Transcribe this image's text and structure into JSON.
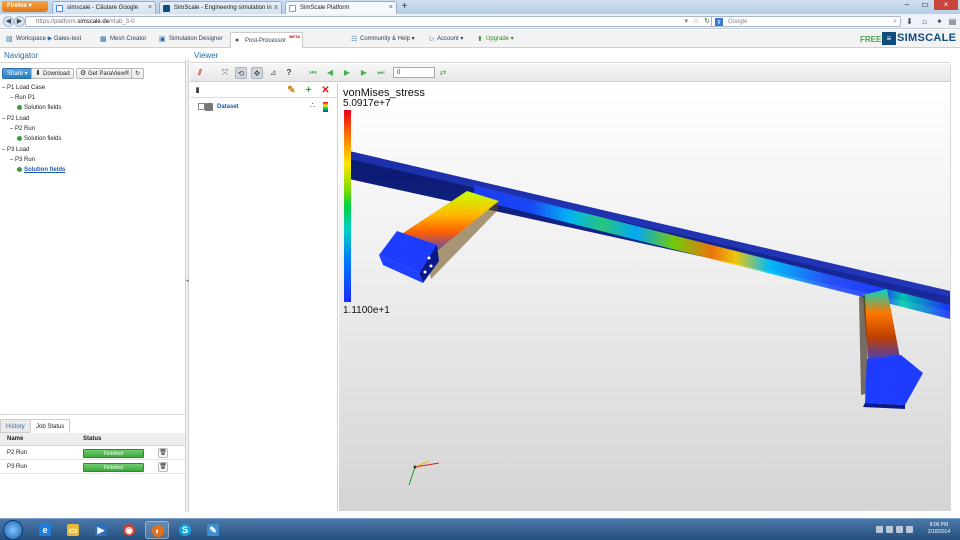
{
  "browser": {
    "menu_label": "Firefox",
    "tabs": [
      {
        "label": "simscale - Căutare Google",
        "active": false
      },
      {
        "label": "SimScale - Engineering simulation in ...",
        "active": false
      },
      {
        "label": "SimScale Platform",
        "active": true
      }
    ],
    "new_tab": "+",
    "url_prefix": "https://platform.",
    "url_host": "simscale.de",
    "url_suffix": "/#tab_3-0",
    "search_placeholder": "Google"
  },
  "app": {
    "breadcrumb_workspace": "Workspace",
    "breadcrumb_project": "Gales-test",
    "tabs": [
      "Mesh Creator",
      "Simulation Designer",
      "Post-Processor"
    ],
    "beta_label": "BETA",
    "menus": [
      "Community & Help",
      "Account",
      "Upgrade"
    ],
    "plan": "FREE",
    "brand": "SIMSCALE"
  },
  "navigator": {
    "title": "Navigator",
    "buttons": [
      "Share",
      "Download",
      "Get ParaView®"
    ],
    "tree": [
      {
        "label": "P1 Load Case",
        "level": 0
      },
      {
        "label": "Run P1",
        "level": 1
      },
      {
        "label": "Solution fields",
        "level": 2
      },
      {
        "label": "P2 Load",
        "level": 0
      },
      {
        "label": "P2 Run",
        "level": 1
      },
      {
        "label": "Solution fields",
        "level": 2
      },
      {
        "label": "P3 Load",
        "level": 0
      },
      {
        "label": "P3 Run",
        "level": 1
      },
      {
        "label": "Solution fields",
        "level": 2
      }
    ]
  },
  "jobs": {
    "tabs": [
      "History",
      "Job Status"
    ],
    "columns": [
      "Name",
      "Status"
    ],
    "rows": [
      {
        "name": "P2 Run",
        "status": "Finished"
      },
      {
        "name": "P3 Run",
        "status": "Finished"
      }
    ]
  },
  "viewer": {
    "title": "Viewer",
    "frame_value": "0",
    "pipeline_item": "Dataset",
    "legend": {
      "field": "vonMises_stress",
      "max": "5.0917e+7",
      "min": "1.1100e+1"
    }
  },
  "taskbar": {
    "time": "8:06 PM",
    "date": "2/18/2014"
  },
  "colors": {
    "accent": "#2a6aa8",
    "brand": "#0f4c7e",
    "success": "#3ea83e"
  }
}
